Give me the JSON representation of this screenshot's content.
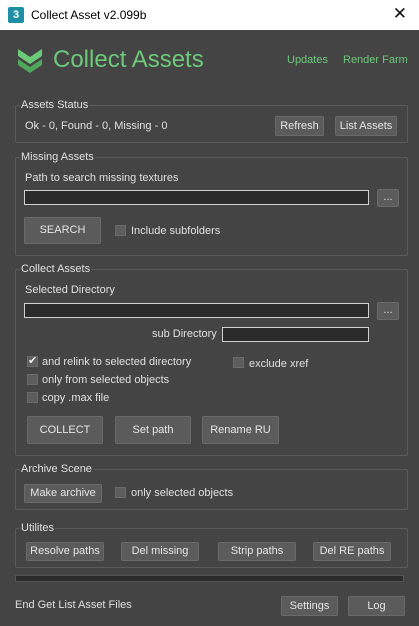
{
  "window": {
    "icon_glyph": "3",
    "title": "Collect Asset v2.099b",
    "close_glyph": "✕"
  },
  "header": {
    "logo_icon": "layers-chevron-icon",
    "logo_text": "Collect Assets",
    "links": [
      "Updates",
      "Render Farm"
    ],
    "accent_color": "#6dc97a"
  },
  "assets_status": {
    "title": "Assets Status",
    "status_text": "Ok - 0, Found - 0, Missing - 0",
    "refresh_label": "Refresh",
    "list_assets_label": "List Assets"
  },
  "missing_assets": {
    "title": "Missing Assets",
    "path_label": "Path to search missing textures",
    "path_value": "",
    "browse_label": "...",
    "search_label": "SEARCH",
    "include_subfolders_label": "Include subfolders",
    "include_subfolders_checked": false
  },
  "collect_assets": {
    "title": "Collect Assets",
    "selected_dir_label": "Selected Directory",
    "selected_dir_value": "",
    "browse_label": "...",
    "sub_dir_label": "sub Directory",
    "sub_dir_value": "",
    "relink_label": "and relink to selected directory",
    "relink_checked": true,
    "exclude_xref_label": "exclude xref",
    "exclude_xref_checked": false,
    "only_selected_label": "only from selected objects",
    "only_selected_checked": false,
    "copy_max_label": "copy .max file",
    "copy_max_checked": false,
    "collect_label": "COLLECT",
    "set_path_label": "Set path",
    "rename_label": "Rename RU"
  },
  "archive_scene": {
    "title": "Archive Scene",
    "make_archive_label": "Make archive",
    "only_selected_label": "only selected objects",
    "only_selected_checked": false
  },
  "utilites": {
    "title": "Utilites",
    "resolve_label": "Resolve paths",
    "del_missing_label": "Del missing",
    "strip_label": "Strip paths",
    "del_re_label": "Del RE paths"
  },
  "footer": {
    "status_text": "End Get List Asset Files",
    "settings_label": "Settings",
    "log_label": "Log",
    "progress": 0
  }
}
